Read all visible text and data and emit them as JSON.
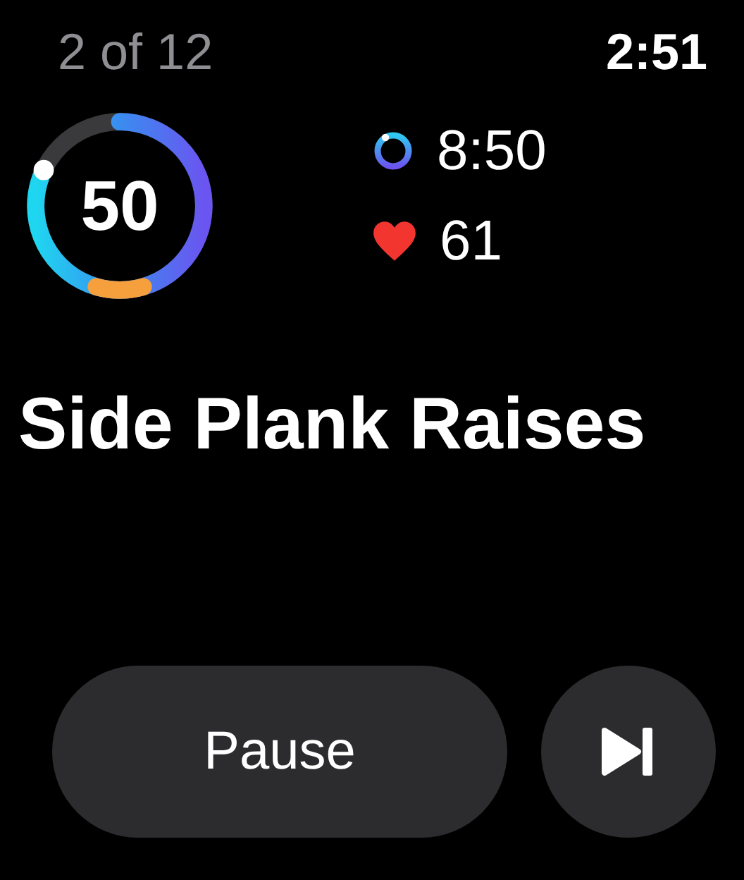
{
  "header": {
    "counter": "2 of 12",
    "time": "2:51"
  },
  "ring": {
    "value": "50",
    "level": 0.82
  },
  "metrics": [
    {
      "kind": "timer",
      "value": "8:50"
    },
    {
      "kind": "heart",
      "value": "61"
    }
  ],
  "exercise": {
    "title": "Side Plank Raises"
  },
  "controls": {
    "pause": "Pause"
  }
}
